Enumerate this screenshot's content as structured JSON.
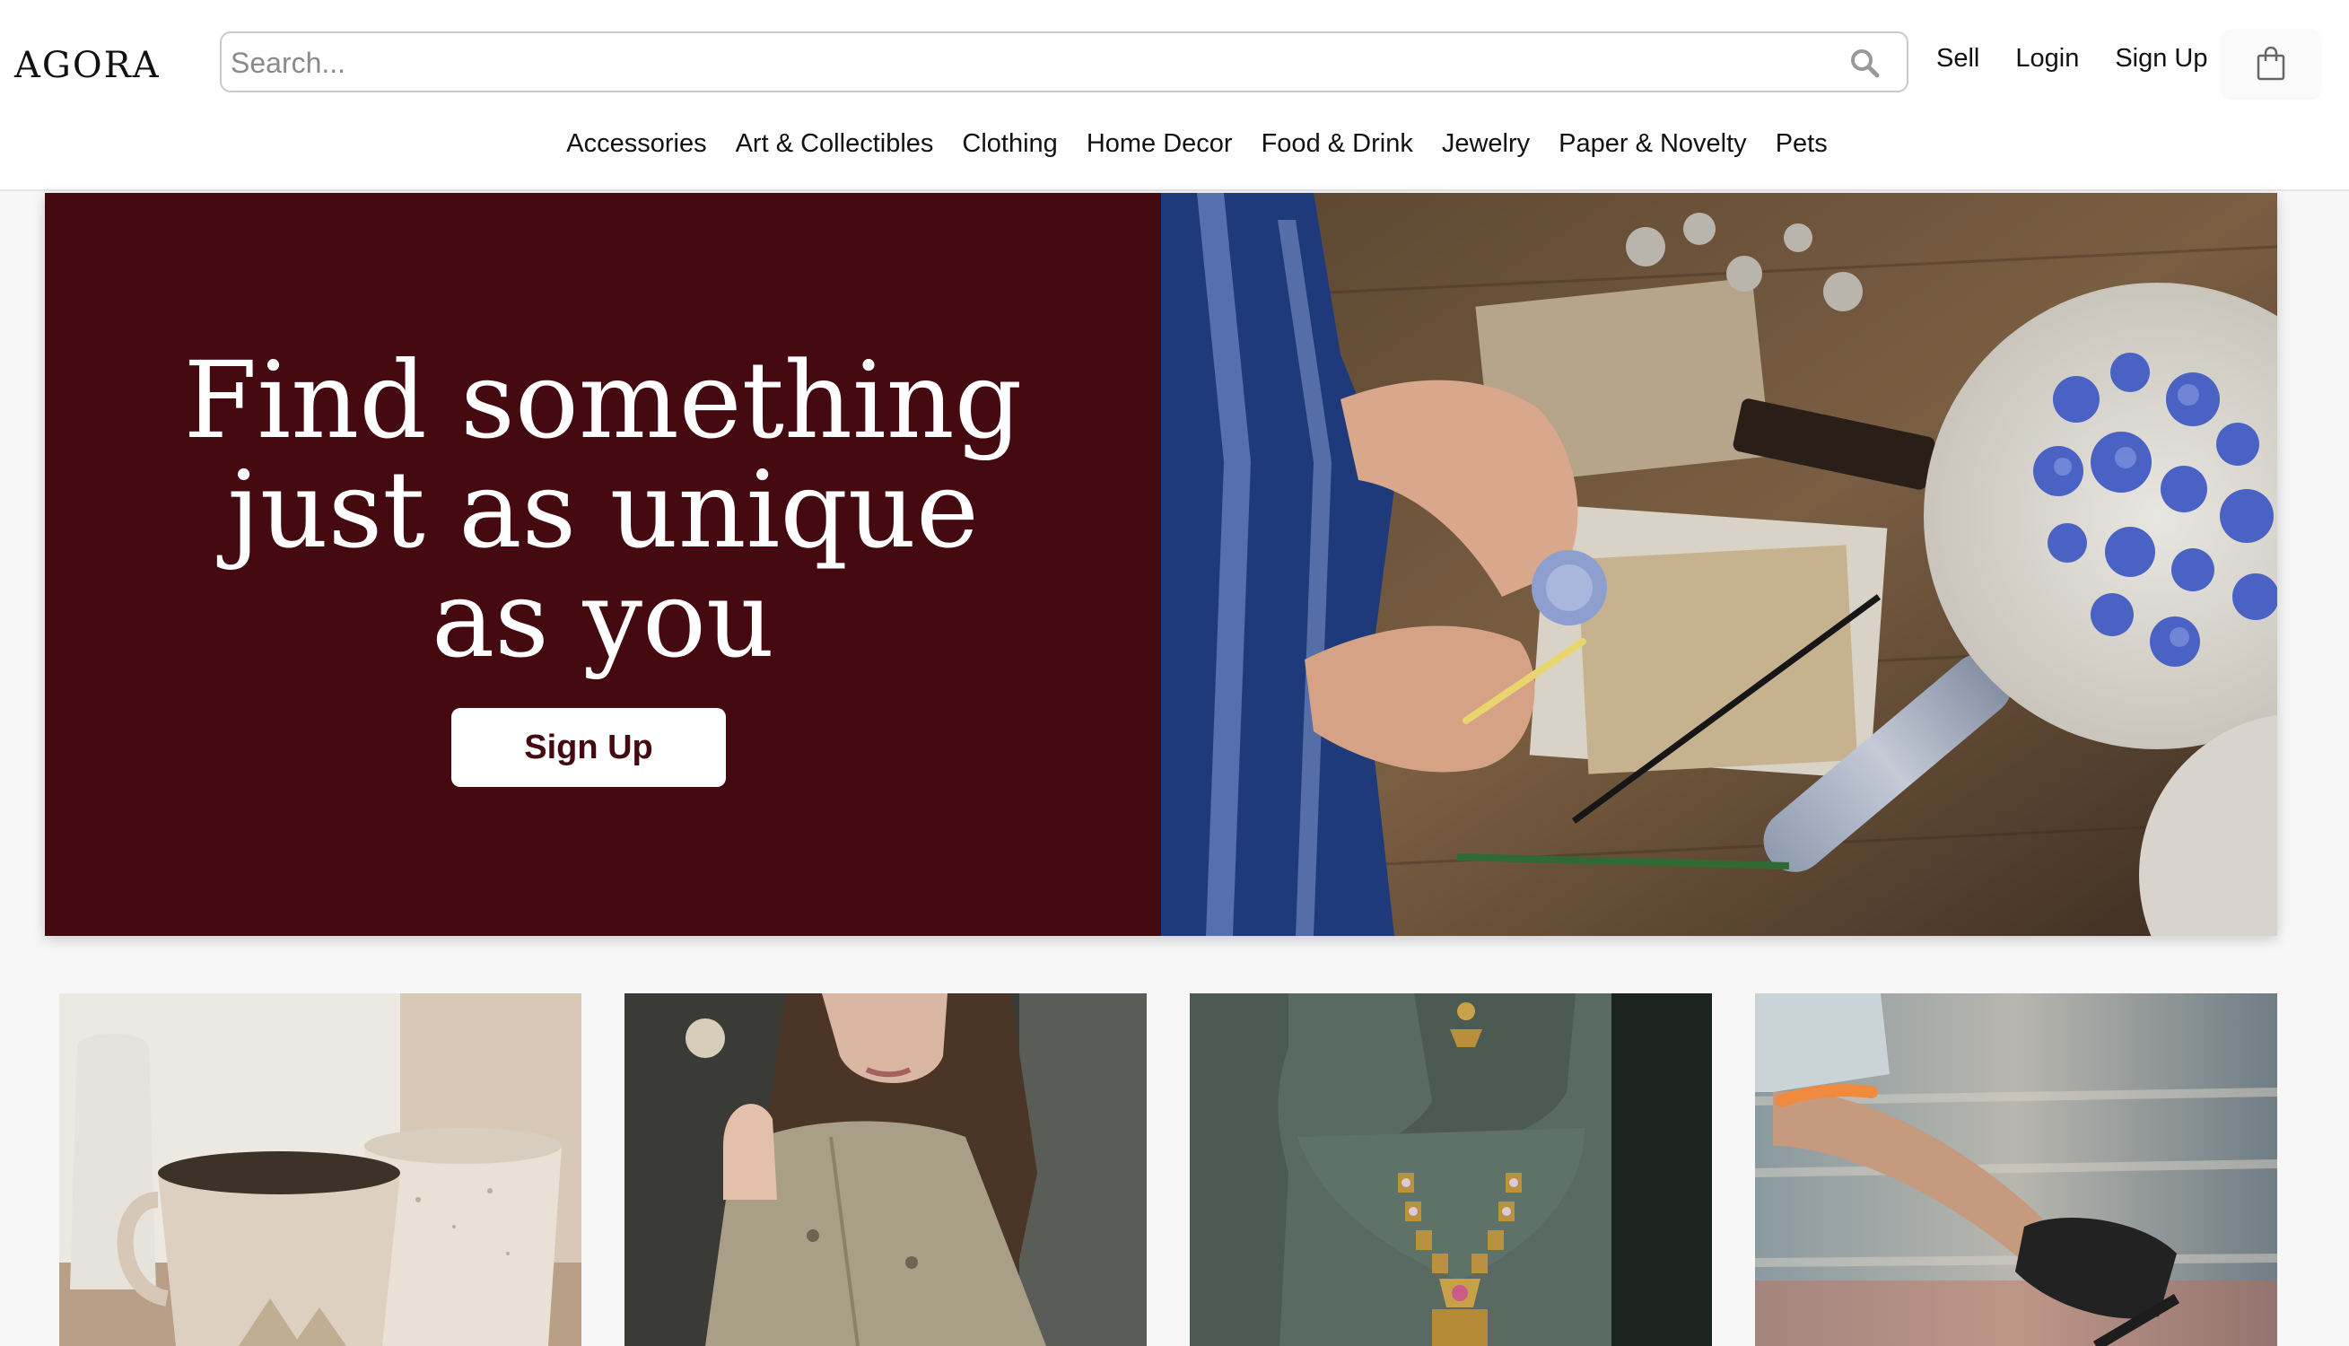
{
  "header": {
    "logo": "AGORA",
    "search": {
      "placeholder": "Search...",
      "value": ""
    },
    "links": {
      "sell": "Sell",
      "login": "Login",
      "signup": "Sign Up"
    },
    "cart_icon": "shopping-bag-icon"
  },
  "categories": [
    "Accessories",
    "Art & Collectibles",
    "Clothing",
    "Home Decor",
    "Food & Drink",
    "Jewelry",
    "Paper & Novelty",
    "Pets"
  ],
  "hero": {
    "title_line1": "Find something",
    "title_line2": "just as unique",
    "title_line3": "as you",
    "button": "Sign Up",
    "image": "wax-seal-crafting-photo"
  },
  "tiles": [
    {
      "image": "ceramic-mugs-photo"
    },
    {
      "image": "woman-in-trench-coat-photo"
    },
    {
      "image": "gold-necklace-on-bust-photo"
    },
    {
      "image": "cyclist-photo"
    }
  ],
  "colors": {
    "hero_background": "#450a10",
    "accent": "#450a10",
    "page_background": "#f7f7f7"
  }
}
